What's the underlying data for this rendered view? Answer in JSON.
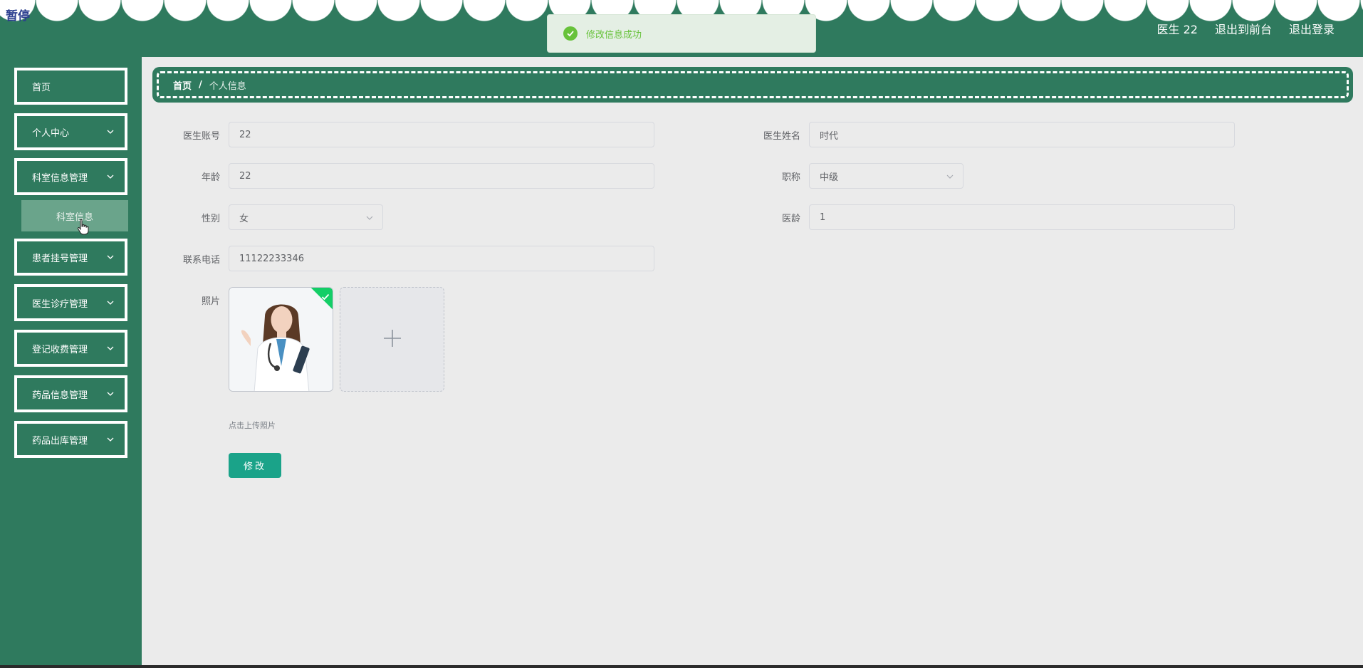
{
  "header": {
    "brand": "暂停",
    "user": "医生 22",
    "to_front": "退出到前台",
    "logout": "退出登录"
  },
  "toast": {
    "message": "修改信息成功"
  },
  "sidebar": {
    "items": [
      {
        "label": "首页"
      },
      {
        "label": "个人中心"
      },
      {
        "label": "科室信息管理"
      },
      {
        "label": "患者挂号管理"
      },
      {
        "label": "医生诊疗管理"
      },
      {
        "label": "登记收费管理"
      },
      {
        "label": "药品信息管理"
      },
      {
        "label": "药品出库管理"
      }
    ],
    "sub_item": "科室信息"
  },
  "breadcrumb": {
    "home": "首页",
    "separator": "/",
    "current": "个人信息"
  },
  "form": {
    "account_label": "医生账号",
    "account_value": "22",
    "name_label": "医生姓名",
    "name_value": "时代",
    "age_label": "年龄",
    "age_value": "22",
    "title_label": "职称",
    "title_value": "中级",
    "gender_label": "性别",
    "gender_value": "女",
    "years_label": "医龄",
    "years_value": "1",
    "phone_label": "联系电话",
    "phone_value": "11122233346",
    "photo_label": "照片",
    "photo_hint": "点击上传照片",
    "submit_label": "修改"
  },
  "colors": {
    "primary": "#2f7a5e",
    "button": "#1aa389",
    "success": "#67c23a"
  }
}
